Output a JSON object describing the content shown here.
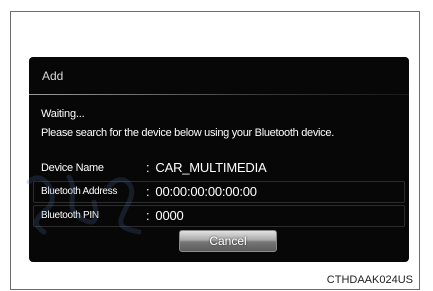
{
  "dialog": {
    "title": "Add",
    "status": "Waiting...",
    "instruction": "Please search for the device below using your Bluetooth device.",
    "rows": [
      {
        "label": "Device Name",
        "value": "CAR_MULTIMEDIA"
      },
      {
        "label": "Bluetooth Address",
        "value": "00:00:00:00:00:00"
      },
      {
        "label": "Bluetooth PIN",
        "value": "0000"
      }
    ],
    "cancel_label": "Cancel"
  },
  "figure_code": "CTHDAAK024US",
  "watermark": {
    "color": "#4a6fa5",
    "icon": "decorative-script-watermark"
  }
}
